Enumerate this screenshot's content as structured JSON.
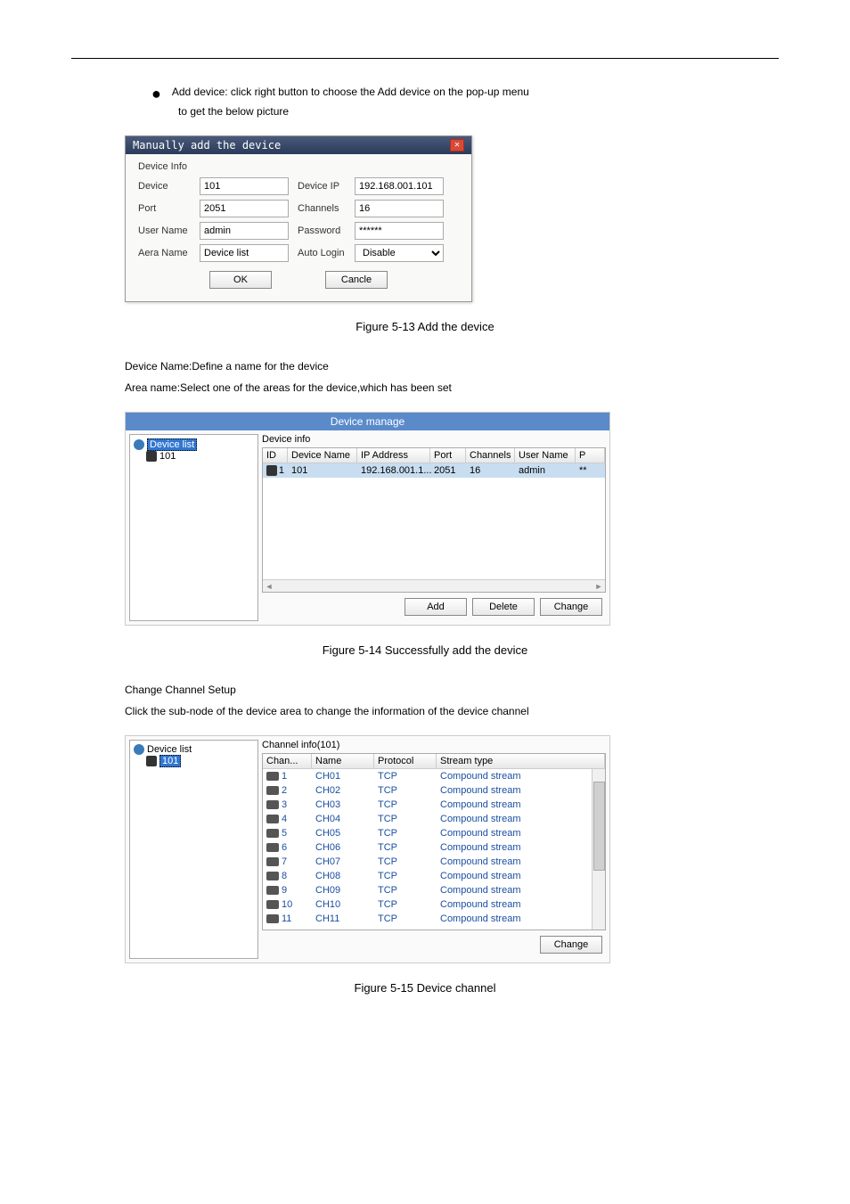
{
  "bullet_text": "Add device: click right button to choose the Add device on the pop-up menu",
  "bullet_cont": "to get the below picture",
  "dialog1": {
    "title": "Manually add the device",
    "section_label": "Device Info",
    "labels": {
      "device": "Device",
      "device_ip": "Device IP",
      "port": "Port",
      "channels": "Channels",
      "user_name": "User Name",
      "password": "Password",
      "area_name": "Aera Name",
      "auto_login": "Auto Login"
    },
    "values": {
      "device": "101",
      "device_ip": "192.168.001.101",
      "port": "2051",
      "channels": "16",
      "user_name": "admin",
      "password": "******",
      "area_name": "Device list",
      "auto_login": "Disable"
    },
    "buttons": {
      "ok": "OK",
      "cancel": "Cancle"
    }
  },
  "figure5_13_caption": "Figure 5-13 Add the device",
  "figure5_13_below1": "Device Name:Define a name for the device",
  "figure5_13_below2": "Area name:Select one of the areas for the device,which has been set",
  "dialog2": {
    "title": "Device manage",
    "tree": {
      "root": "Device list",
      "child": "101"
    },
    "panel_title": "Device info",
    "headers": {
      "id": "ID",
      "device_name": "Device Name",
      "ip_address": "IP Address",
      "port": "Port",
      "channels": "Channels",
      "user_name": "User Name",
      "extra": "P"
    },
    "row": {
      "id": "1",
      "device_name": "101",
      "ip_address": "192.168.001.1...",
      "port": "2051",
      "channels": "16",
      "user_name": "admin",
      "extra": "**"
    },
    "buttons": {
      "add": "Add",
      "delete": "Delete",
      "change": "Change"
    }
  },
  "figure5_14_caption": "Figure 5-14 Successfully add the device",
  "below_5_14_1": "Change Channel Setup",
  "below_5_14_2": "Click the sub-node of the device area to change the information of the device channel",
  "dialog3": {
    "tree": {
      "root": "Device list",
      "child": "101"
    },
    "panel_title": "Channel info(101)",
    "headers": {
      "chan": "Chan...",
      "name": "Name",
      "protocol": "Protocol",
      "stream_type": "Stream type"
    },
    "rows": [
      {
        "chan": "1",
        "name": "CH01",
        "protocol": "TCP",
        "stream": "Compound stream"
      },
      {
        "chan": "2",
        "name": "CH02",
        "protocol": "TCP",
        "stream": "Compound stream"
      },
      {
        "chan": "3",
        "name": "CH03",
        "protocol": "TCP",
        "stream": "Compound stream"
      },
      {
        "chan": "4",
        "name": "CH04",
        "protocol": "TCP",
        "stream": "Compound stream"
      },
      {
        "chan": "5",
        "name": "CH05",
        "protocol": "TCP",
        "stream": "Compound stream"
      },
      {
        "chan": "6",
        "name": "CH06",
        "protocol": "TCP",
        "stream": "Compound stream"
      },
      {
        "chan": "7",
        "name": "CH07",
        "protocol": "TCP",
        "stream": "Compound stream"
      },
      {
        "chan": "8",
        "name": "CH08",
        "protocol": "TCP",
        "stream": "Compound stream"
      },
      {
        "chan": "9",
        "name": "CH09",
        "protocol": "TCP",
        "stream": "Compound stream"
      },
      {
        "chan": "10",
        "name": "CH10",
        "protocol": "TCP",
        "stream": "Compound stream"
      },
      {
        "chan": "11",
        "name": "CH11",
        "protocol": "TCP",
        "stream": "Compound stream"
      }
    ],
    "button": "Change"
  },
  "figure5_15_caption": "Figure 5-15 Device channel"
}
